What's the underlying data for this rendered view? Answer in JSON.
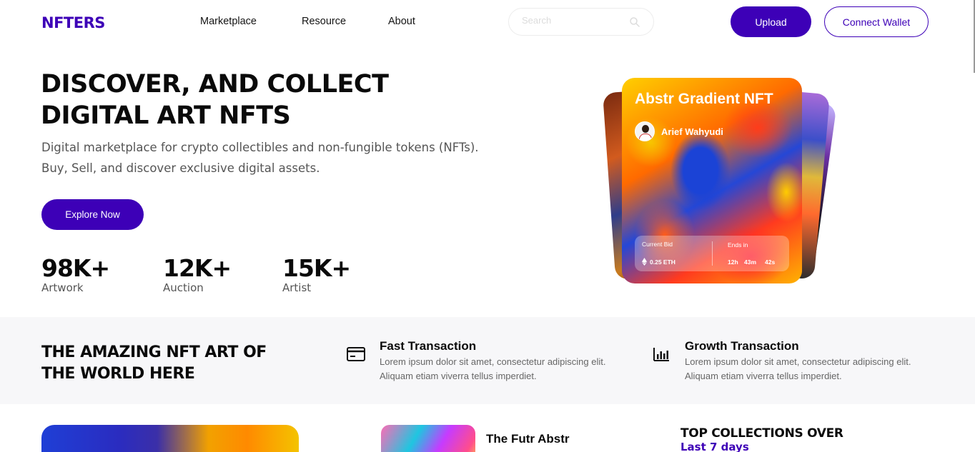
{
  "header": {
    "logo": "NFTERS",
    "nav": [
      "Marketplace",
      "Resource",
      "About"
    ],
    "search_placeholder": "Search",
    "upload_label": "Upload",
    "connect_wallet_label": "Connect Wallet"
  },
  "hero": {
    "title_line1": "DISCOVER, AND COLLECT",
    "title_line2": "DIGITAL ART NFTS",
    "subtitle_line1": "Digital marketplace for crypto collectibles and non-fungible tokens (NFTs).",
    "subtitle_line2": "Buy, Sell, and discover exclusive digital assets.",
    "explore_label": "Explore Now",
    "stats": [
      {
        "value": "98K+",
        "label": "Artwork"
      },
      {
        "value": "12K+",
        "label": "Auction"
      },
      {
        "value": "15K+",
        "label": "Artist"
      }
    ]
  },
  "featured_card": {
    "title": "Abstr Gradient NFT",
    "author": "Arief Wahyudi",
    "current_bid_label": "Current Bid",
    "current_bid_value": "0.25 ETH",
    "ends_in_label": "Ends in",
    "ends_hours": "12h",
    "ends_minutes": "43m",
    "ends_seconds": "42s"
  },
  "features": {
    "title_line1": "THE AMAZING NFT ART OF",
    "title_line2": "THE WORLD HERE",
    "items": [
      {
        "icon": "credit-card-icon",
        "title": "Fast Transaction",
        "desc_line1": "Lorem ipsum dolor sit amet, consectetur adipiscing elit.",
        "desc_line2": "Aliquam etiam viverra tellus imperdiet."
      },
      {
        "icon": "bar-chart-icon",
        "title": "Growth Transaction",
        "desc_line1": "Lorem ipsum dolor sit amet, consectetur adipiscing elit.",
        "desc_line2": "Aliquam etiam viverra tellus imperdiet."
      }
    ]
  },
  "bottom": {
    "card2_title": "The Futr Abstr",
    "top_collections_title": "TOP COLLECTIONS OVER",
    "top_collections_sub": "Last 7 days"
  },
  "colors": {
    "brand": "#3D00B7",
    "band_bg": "#F7F7F9"
  }
}
